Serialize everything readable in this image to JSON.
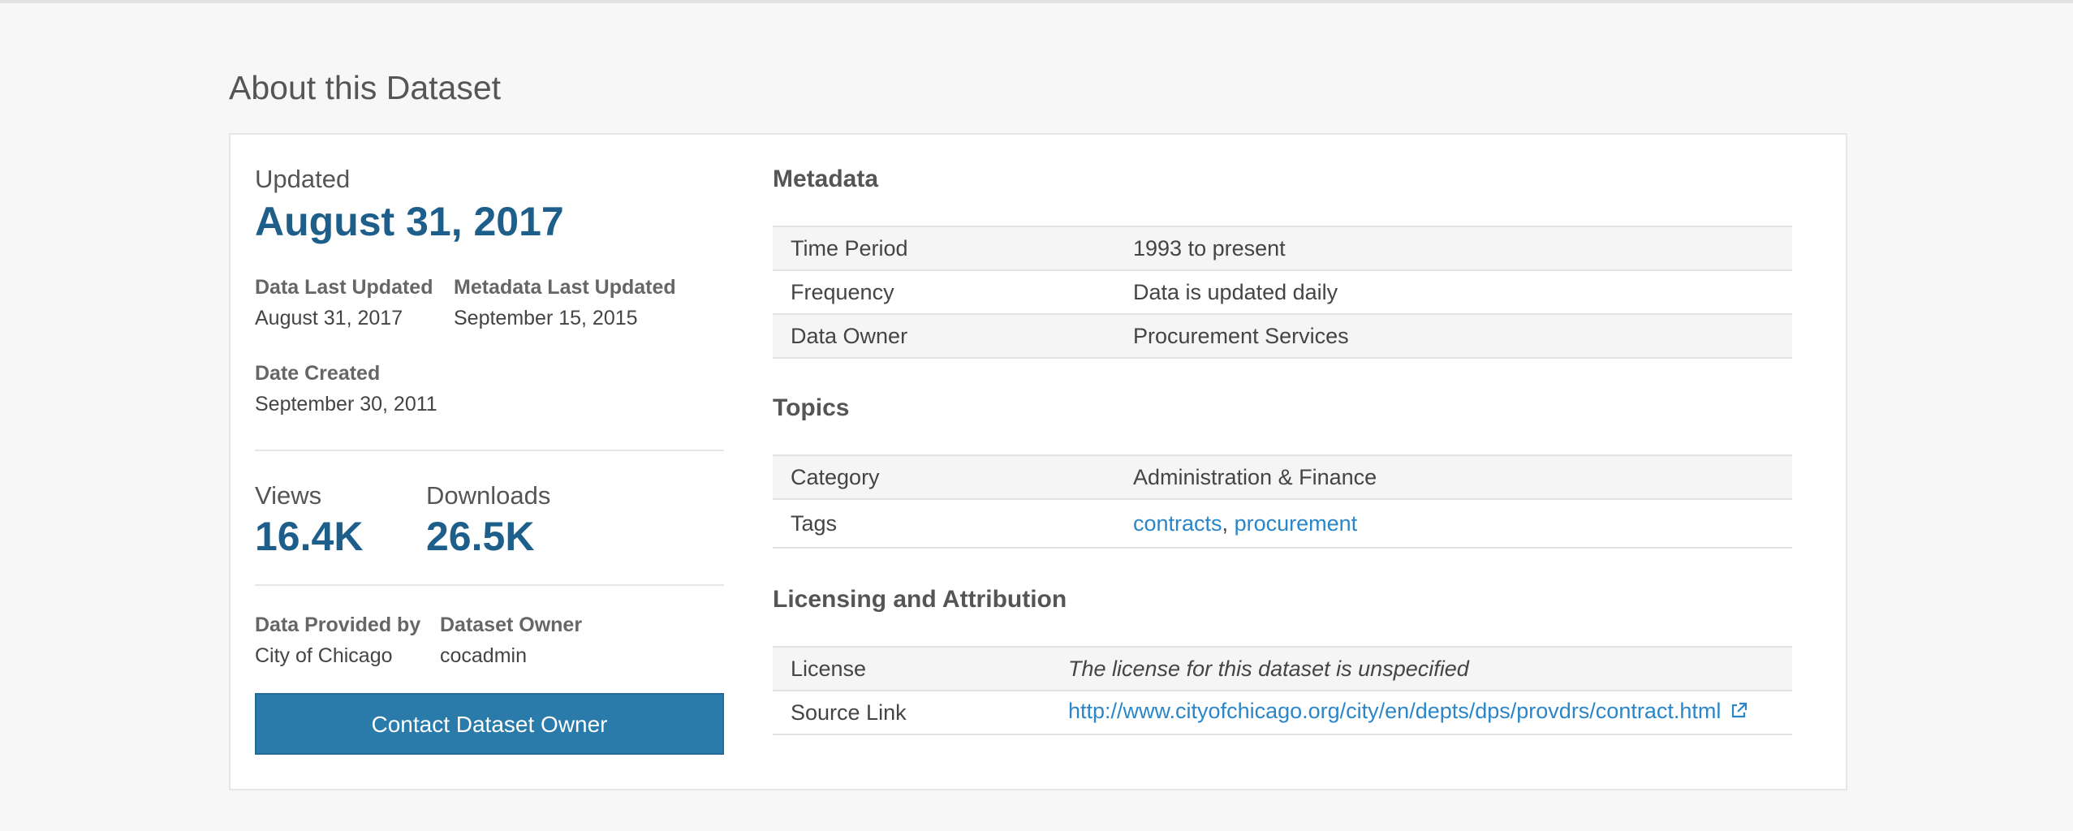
{
  "page": {
    "title": "About this Dataset"
  },
  "summary": {
    "updated_label": "Updated",
    "updated_date": "August 31, 2017",
    "data_last_updated_label": "Data Last Updated",
    "data_last_updated_value": "August 31, 2017",
    "metadata_last_updated_label": "Metadata Last Updated",
    "metadata_last_updated_value": "September 15, 2015",
    "date_created_label": "Date Created",
    "date_created_value": "September 30, 2011",
    "views_label": "Views",
    "views_value": "16.4K",
    "downloads_label": "Downloads",
    "downloads_value": "26.5K",
    "provided_by_label": "Data Provided by",
    "provided_by_value": "City of Chicago",
    "owner_label": "Dataset Owner",
    "owner_value": "cocadmin",
    "contact_button": "Contact Dataset Owner"
  },
  "metadata": {
    "title": "Metadata",
    "rows": [
      {
        "label": "Time Period",
        "value": "1993 to present"
      },
      {
        "label": "Frequency",
        "value": "Data is updated daily"
      },
      {
        "label": "Data Owner",
        "value": "Procurement Services"
      }
    ]
  },
  "topics": {
    "title": "Topics",
    "category_label": "Category",
    "category_value": "Administration & Finance",
    "tags_label": "Tags",
    "tags": [
      "contracts",
      "procurement"
    ],
    "tag_separator": ","
  },
  "licensing": {
    "title": "Licensing and Attribution",
    "license_label": "License",
    "license_value": "The license for this dataset is unspecified",
    "source_label": "Source Link",
    "source_value": "http://www.cityofchicago.org/city/en/depts/dps/provdrs/contract.html"
  },
  "icons": {
    "source_link": "external-link-icon"
  },
  "colors": {
    "accent": "#1d5f8a",
    "link": "#2a86c8",
    "button": "#2a7aaa"
  }
}
